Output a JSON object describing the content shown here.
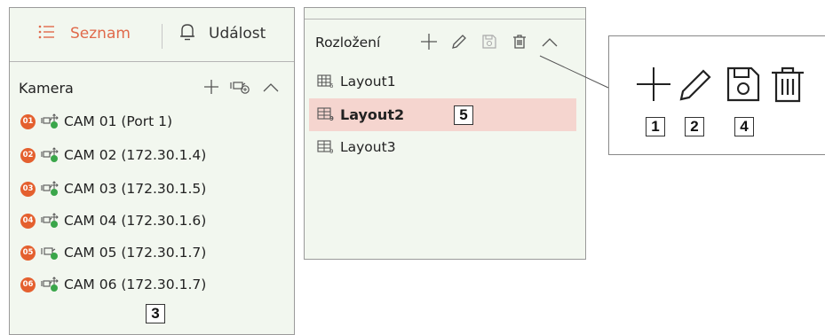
{
  "tabs": {
    "list_label": "Seznam",
    "event_label": "Událost"
  },
  "camera_section": {
    "title": "Kamera",
    "cameras": [
      {
        "badge": "01",
        "name": "CAM 01 (Port 1)"
      },
      {
        "badge": "02",
        "name": "CAM 02 (172.30.1.4)"
      },
      {
        "badge": "03",
        "name": "CAM 03 (172.30.1.5)"
      },
      {
        "badge": "04",
        "name": "CAM 04 (172.30.1.6)"
      },
      {
        "badge": "05",
        "name": "CAM 05 (172.30.1.7)"
      },
      {
        "badge": "06",
        "name": "CAM 06 (172.30.1.7)"
      }
    ],
    "callout": "3"
  },
  "layout_section": {
    "title": "Rozložení",
    "layouts": [
      {
        "name": "Layout1",
        "selected": false
      },
      {
        "name": "Layout2",
        "selected": true
      },
      {
        "name": "Layout3",
        "selected": false
      }
    ],
    "callout": "5"
  },
  "zoom": {
    "callouts": [
      "1",
      "2",
      "4"
    ]
  },
  "colors": {
    "accent": "#e06a4b",
    "panel_bg": "#f2f7ef",
    "selection": "#f5d5cf",
    "badge": "#e4602f"
  },
  "icons": [
    "list-icon",
    "bell-icon",
    "add-icon",
    "add-camera-icon",
    "collapse-icon",
    "camera-move-icon",
    "camera-icon",
    "edit-icon",
    "save-icon",
    "delete-icon",
    "layout-icon"
  ]
}
